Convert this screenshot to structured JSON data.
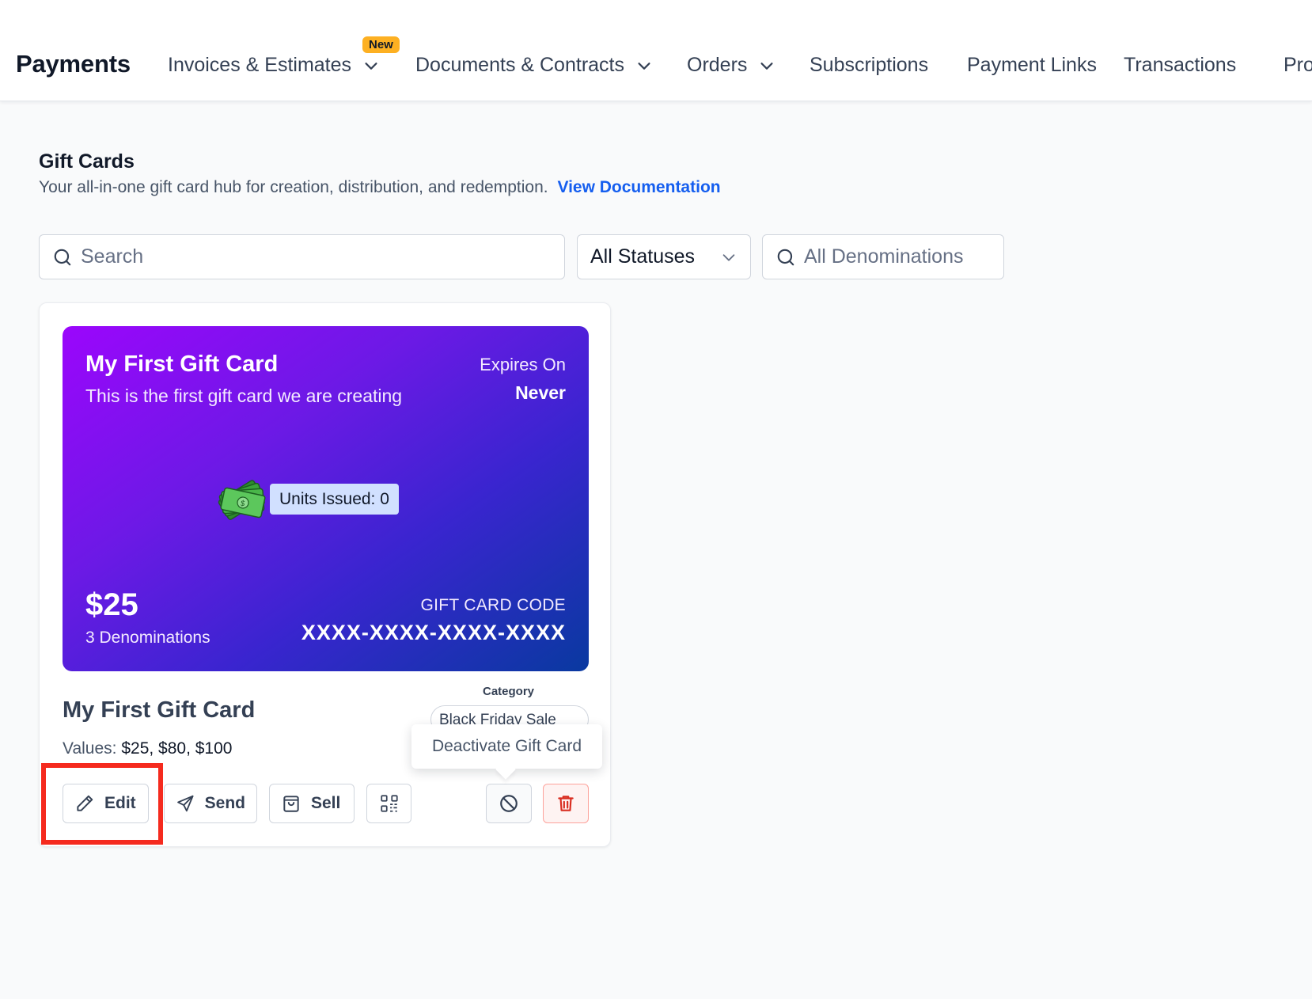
{
  "header": {
    "app_title": "Payments",
    "nav": [
      {
        "label": "Invoices & Estimates",
        "badge": "New",
        "has_dropdown": true
      },
      {
        "label": "Documents & Contracts",
        "has_dropdown": true
      },
      {
        "label": "Orders",
        "has_dropdown": true
      },
      {
        "label": "Subscriptions"
      },
      {
        "label": "Payment Links"
      },
      {
        "label": "Transactions"
      },
      {
        "label": "Pro"
      }
    ]
  },
  "page": {
    "title": "Gift Cards",
    "subtitle": "Your all-in-one gift card hub for creation, distribution, and redemption.",
    "doc_link": "View Documentation"
  },
  "filters": {
    "search_placeholder": "Search",
    "status_value": "All Statuses",
    "denominations_placeholder": "All Denominations"
  },
  "gift_card": {
    "preview": {
      "name": "My First Gift Card",
      "description": "This is the first gift card we are creating",
      "expires_label": "Expires On",
      "expires_value": "Never",
      "units_issued": "Units Issued: 0",
      "amount": "$25",
      "denominations": "3 Denominations",
      "code_label": "GIFT CARD CODE",
      "code_value": "XXXX-XXXX-XXXX-XXXX",
      "gradient": [
        "#9b06fc",
        "#0939a0"
      ]
    },
    "name": "My First Gift Card",
    "values_label": "Values:",
    "values": "$25, $80, $100",
    "category_label": "Category",
    "category_value": "Black Friday Sale",
    "tooltip": "Deactivate Gift Card",
    "actions": {
      "edit": "Edit",
      "send": "Send",
      "sell": "Sell"
    }
  },
  "colors": {
    "link": "#155eef",
    "badge": "#fdb022",
    "highlight": "#f52a1e",
    "delete": "#d92d20"
  }
}
